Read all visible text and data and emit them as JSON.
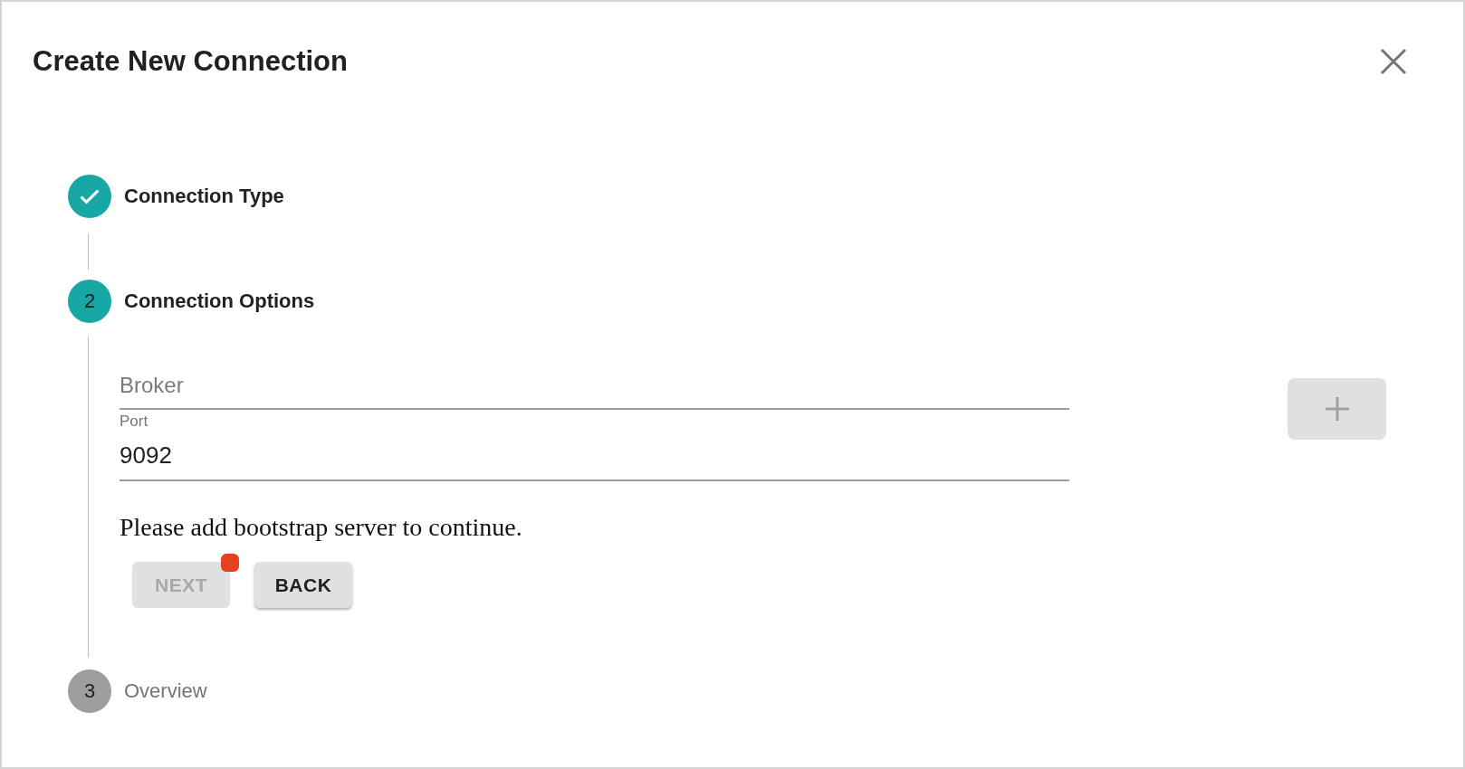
{
  "dialog": {
    "title": "Create New Connection"
  },
  "steps": [
    {
      "label": "Connection Type",
      "kind": "completed"
    },
    {
      "number": "2",
      "label": "Connection Options",
      "kind": "active"
    },
    {
      "number": "3",
      "label": "Overview",
      "kind": "pending"
    }
  ],
  "form": {
    "fields": [
      {
        "placeholder": "Broker"
      },
      {
        "label": "Port",
        "value": "9092"
      }
    ],
    "add_button": {
      "disabled": true
    },
    "message": "Please add bootstrap server to continue.",
    "buttons": [
      {
        "label": "NEXT",
        "disabled": true,
        "badge": true
      },
      {
        "label": "BACK",
        "disabled": false,
        "badge": false
      }
    ]
  }
}
